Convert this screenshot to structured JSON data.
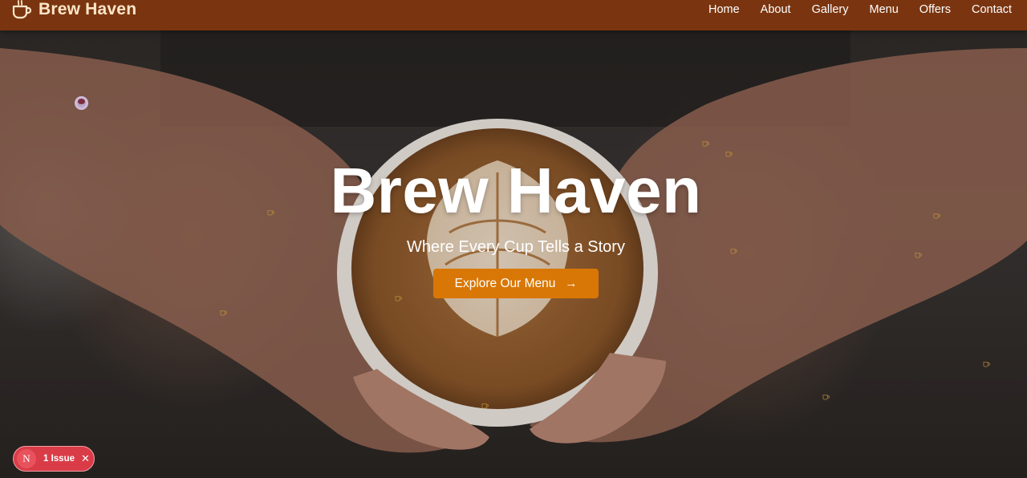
{
  "brand": {
    "name": "Brew Haven",
    "icon": "coffee-cup-icon"
  },
  "nav": {
    "items": [
      {
        "label": "Home"
      },
      {
        "label": "About"
      },
      {
        "label": "Gallery"
      },
      {
        "label": "Menu"
      },
      {
        "label": "Offers"
      },
      {
        "label": "Contact"
      }
    ]
  },
  "hero": {
    "title": "Brew Haven",
    "subtitle": "Where Every Cup Tells a Story",
    "cta_label": "Explore Our Menu",
    "cta_icon": "arrow-right-icon",
    "background": "latte-art-cup-in-hands-photo"
  },
  "issues": {
    "logo": "N",
    "label": "1 Issue",
    "close_icon": "close-icon"
  },
  "colors": {
    "navbar": "#7a3510",
    "brand_text": "#fde6c8",
    "cta": "#d97706",
    "issue_badge": "#d93c47"
  }
}
